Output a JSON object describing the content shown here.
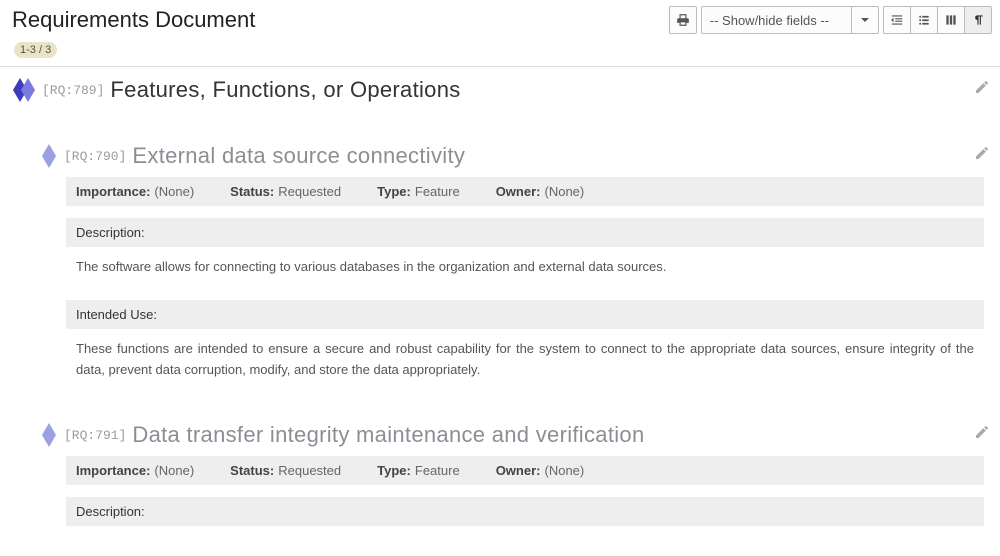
{
  "header": {
    "title": "Requirements Document",
    "field_dropdown_label": "-- Show/hide fields --"
  },
  "page_counter": "1-3 / 3",
  "section": {
    "id": "[RQ:789]",
    "title": "Features, Functions, or Operations"
  },
  "req1": {
    "id": "[RQ:790]",
    "title": "External data source connectivity",
    "importance_label": "Importance",
    "importance_value": "(None)",
    "status_label": "Status",
    "status_value": "Requested",
    "type_label": "Type",
    "type_value": "Feature",
    "owner_label": "Owner",
    "owner_value": "(None)",
    "description_label": "Description:",
    "description_text": "The software allows for connecting to various databases in the organization and external data sources.",
    "intended_label": "Intended Use:",
    "intended_text": "These functions are intended to ensure a secure and robust capability for the system to connect to the appropriate data sources, ensure integrity of the data, prevent data corruption, modify, and store the data appropriately."
  },
  "req2": {
    "id": "[RQ:791]",
    "title": "Data transfer integrity maintenance and verification",
    "importance_label": "Importance",
    "importance_value": "(None)",
    "status_label": "Status",
    "status_value": "Requested",
    "type_label": "Type",
    "type_value": "Feature",
    "owner_label": "Owner",
    "owner_value": "(None)",
    "description_label": "Description:"
  }
}
